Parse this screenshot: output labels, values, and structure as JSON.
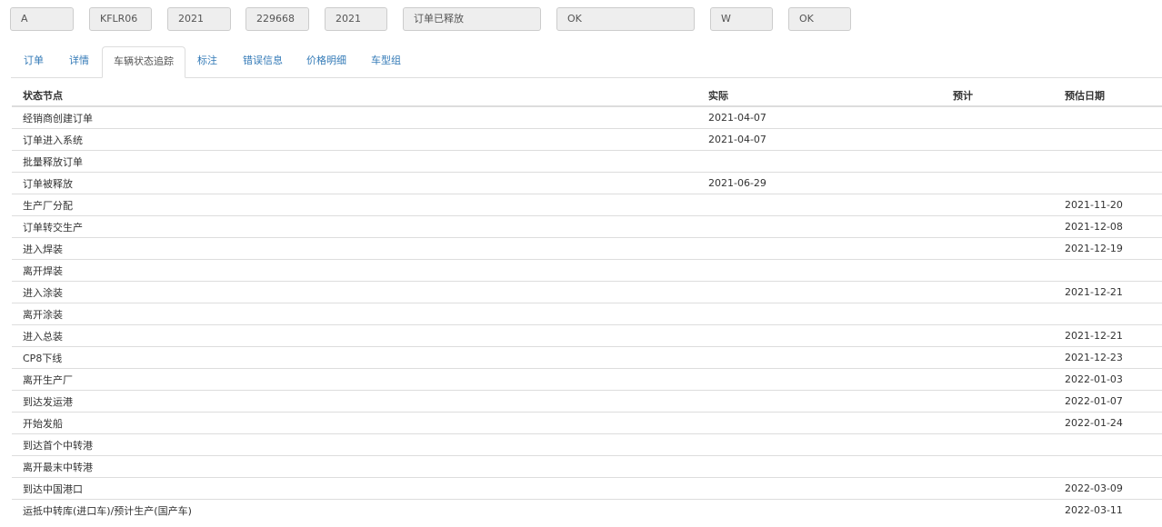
{
  "header_fields": [
    "A",
    "KFLR06",
    "2021",
    "229668",
    "2021",
    "订单已释放",
    "OK",
    "W",
    "OK"
  ],
  "tabs": [
    {
      "label": "订单",
      "active": false
    },
    {
      "label": "详情",
      "active": false
    },
    {
      "label": "车辆状态追踪",
      "active": true
    },
    {
      "label": "标注",
      "active": false
    },
    {
      "label": "错误信息",
      "active": false
    },
    {
      "label": "价格明细",
      "active": false
    },
    {
      "label": "车型组",
      "active": false
    }
  ],
  "table": {
    "headers": [
      "状态节点",
      "实际",
      "预计",
      "预估日期"
    ],
    "rows": [
      [
        "经销商创建订单",
        "2021-04-07",
        "",
        ""
      ],
      [
        "订单进入系统",
        "2021-04-07",
        "",
        ""
      ],
      [
        "批量释放订单",
        "",
        "",
        ""
      ],
      [
        "订单被释放",
        "2021-06-29",
        "",
        ""
      ],
      [
        "生产厂分配",
        "",
        "",
        "2021-11-20"
      ],
      [
        "订单转交生产",
        "",
        "",
        "2021-12-08"
      ],
      [
        "进入焊装",
        "",
        "",
        "2021-12-19"
      ],
      [
        "离开焊装",
        "",
        "",
        ""
      ],
      [
        "进入涂装",
        "",
        "",
        "2021-12-21"
      ],
      [
        "离开涂装",
        "",
        "",
        ""
      ],
      [
        "进入总装",
        "",
        "",
        "2021-12-21"
      ],
      [
        "CP8下线",
        "",
        "",
        "2021-12-23"
      ],
      [
        "离开生产厂",
        "",
        "",
        "2022-01-03"
      ],
      [
        "到达发运港",
        "",
        "",
        "2022-01-07"
      ],
      [
        "开始发船",
        "",
        "",
        "2022-01-24"
      ],
      [
        "到达首个中转港",
        "",
        "",
        ""
      ],
      [
        "离开最末中转港",
        "",
        "",
        ""
      ],
      [
        "到达中国港口",
        "",
        "",
        "2022-03-09"
      ],
      [
        "运抵中转库(进口车)/预计生产(国产车)",
        "",
        "",
        "2022-03-11"
      ]
    ]
  }
}
